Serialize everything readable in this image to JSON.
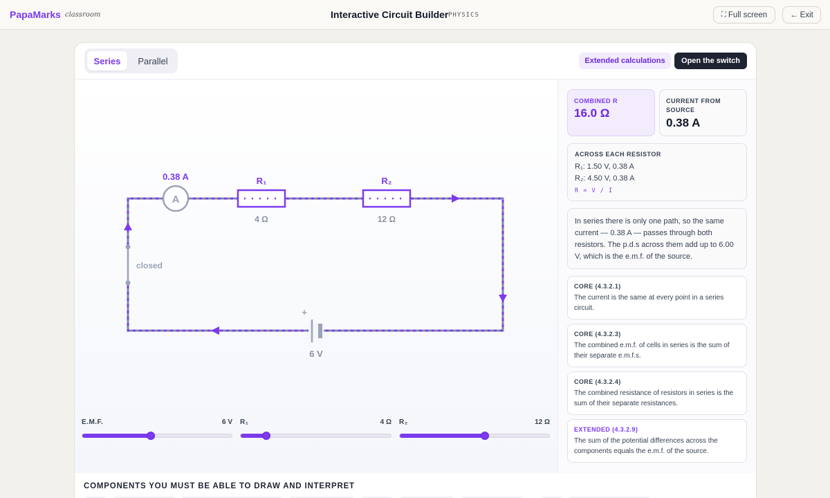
{
  "brand": {
    "name": "PapaMarks",
    "sub": "classroom"
  },
  "header": {
    "title": "Interactive Circuit Builder",
    "subject": "PHYSICS",
    "fullscreen_label": "Full screen",
    "exit_label": "Exit"
  },
  "tabs": [
    {
      "label": "Series",
      "active": true
    },
    {
      "label": "Parallel",
      "active": false
    }
  ],
  "actions": {
    "extended_label": "Extended calculations",
    "switch_label": "Open the switch"
  },
  "circuit": {
    "ammeter_reading": "0.38 A",
    "ammeter_symbol": "A",
    "r1_label": "R₁",
    "r1_value": "4 Ω",
    "r2_label": "R₂",
    "r2_value": "12 Ω",
    "switch_state": "closed",
    "cell_plus": "+",
    "cell_value": "6 V"
  },
  "sliders": [
    {
      "label": "E.M.F.",
      "value_text": "6 V",
      "fraction": 0.46
    },
    {
      "label": "R₁",
      "value_text": "4 Ω",
      "fraction": 0.17
    },
    {
      "label": "R₂",
      "value_text": "12 Ω",
      "fraction": 0.57
    }
  ],
  "stats": {
    "combined_r_label": "COMBINED R",
    "combined_r_value": "16.0 Ω",
    "current_label": "CURRENT FROM SOURCE",
    "current_value": "0.38 A"
  },
  "across": {
    "title": "ACROSS EACH RESISTOR",
    "r1": "R₁: 1.50 V, 0.38 A",
    "r2": "R₂: 4.50 V, 0.38 A",
    "formula": "R = V / I"
  },
  "explanation": "In series there is only one path, so the same current — 0.38 A — passes through both resistors. The p.d.s across them add up to 6.00 V, which is the e.m.f. of the source.",
  "spec_points": [
    {
      "tag": "CORE (4.3.2.1)",
      "text": "The current is the same at every point in a series circuit."
    },
    {
      "tag": "CORE (4.3.2.3)",
      "text": "The combined e.m.f. of cells in series is the sum of their separate e.m.f.s."
    },
    {
      "tag": "CORE (4.3.2.4)",
      "text": "The combined resistance of resistors in series is the sum of their separate resistances."
    },
    {
      "tag": "EXTENDED (4.3.2.9)",
      "text": "The sum of the potential differences across the components equals the e.m.f. of the source."
    }
  ],
  "components_title": "COMPONENTS YOU MUST BE ABLE TO DRAW AND INTERPRET",
  "colors": {
    "accent": "#7c3aed",
    "wire": "#7f8aa3",
    "dark": "#1f2433"
  }
}
